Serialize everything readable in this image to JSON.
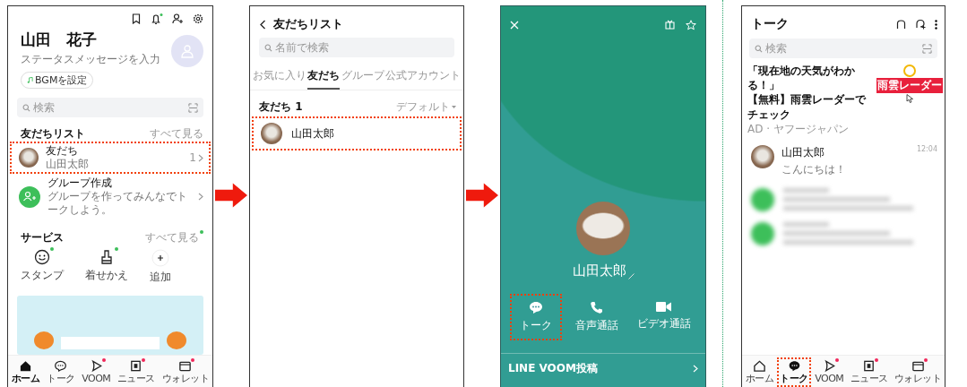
{
  "home_screen": {
    "profile_name": "山田　花子",
    "status_message": "ステータスメッセージを入力",
    "bgm_button": "BGMを設定",
    "search": {
      "placeholder": "検索"
    },
    "friends_section": {
      "title": "友だちリスト",
      "see_all": "すべて見る",
      "see_all_badge": false,
      "rows": [
        {
          "kind": "friends",
          "title": "友だち",
          "subtitle": "山田太郎",
          "count": "1",
          "highlighted": true
        },
        {
          "kind": "create_group",
          "title": "グループ作成",
          "subtitle": "グループを作ってみんなでトークしよう。",
          "highlighted": false
        }
      ]
    },
    "services_section": {
      "title": "サービス",
      "see_all": "すべて見る",
      "see_all_badge": true,
      "items": [
        {
          "kind": "stamp",
          "label": "スタンプ",
          "badge": true
        },
        {
          "kind": "theme",
          "label": "着せかえ",
          "badge": true
        },
        {
          "kind": "add",
          "label": "追加",
          "badge": false
        }
      ]
    },
    "nav": [
      {
        "kind": "home",
        "label": "ホーム",
        "selected": true,
        "badge": false,
        "highlighted": false
      },
      {
        "kind": "talk",
        "label": "トーク",
        "selected": false,
        "badge": false,
        "highlighted": false
      },
      {
        "kind": "voom",
        "label": "VOOM",
        "selected": false,
        "badge": true,
        "highlighted": false
      },
      {
        "kind": "news",
        "label": "ニュース",
        "selected": false,
        "badge": true,
        "highlighted": false
      },
      {
        "kind": "wallet",
        "label": "ウォレット",
        "selected": false,
        "badge": true,
        "highlighted": false
      }
    ]
  },
  "friend_list_screen": {
    "title": "友だちリスト",
    "search": {
      "placeholder": "名前で検索"
    },
    "tabs": [
      {
        "label": "お気に入り",
        "selected": false
      },
      {
        "label": "友だち",
        "selected": true
      },
      {
        "label": "グループ",
        "selected": false
      },
      {
        "label": "公式アカウント",
        "selected": false
      }
    ],
    "section_title": "友だち 1",
    "sort": "デフォルト",
    "rows": [
      {
        "name": "山田太郎",
        "highlighted": true
      }
    ]
  },
  "profile_screen": {
    "name": "山田太郎",
    "actions": [
      {
        "kind": "talk",
        "label": "トーク",
        "highlighted": true
      },
      {
        "kind": "voice",
        "label": "音声通話",
        "highlighted": false
      },
      {
        "kind": "video",
        "label": "ビデオ通話",
        "highlighted": false
      }
    ],
    "voom_link": "LINE VOOM投稿"
  },
  "talk_screen": {
    "title": "トーク",
    "search": {
      "placeholder": "検索"
    },
    "ad": {
      "lines": [
        "「現在地の天気がわかる！」",
        "【無料】雨雲レーダーでチェック"
      ],
      "sponsor": "AD · ヤフージャパン",
      "badge": "雨雲レーダー"
    },
    "chats": [
      {
        "blurred": false,
        "name": "山田太郎",
        "message": "こんにちは！",
        "time": "12:04"
      },
      {
        "blurred": true
      },
      {
        "blurred": true
      }
    ],
    "nav": [
      {
        "kind": "home",
        "label": "ホーム",
        "selected": false,
        "badge": false,
        "highlighted": false
      },
      {
        "kind": "talk",
        "label": "トーク",
        "selected": true,
        "badge": false,
        "highlighted": true
      },
      {
        "kind": "voom",
        "label": "VOOM",
        "selected": false,
        "badge": true,
        "highlighted": false
      },
      {
        "kind": "news",
        "label": "ニュース",
        "selected": false,
        "badge": true,
        "highlighted": false
      },
      {
        "kind": "wallet",
        "label": "ウォレット",
        "selected": false,
        "badge": true,
        "highlighted": false
      }
    ]
  }
}
